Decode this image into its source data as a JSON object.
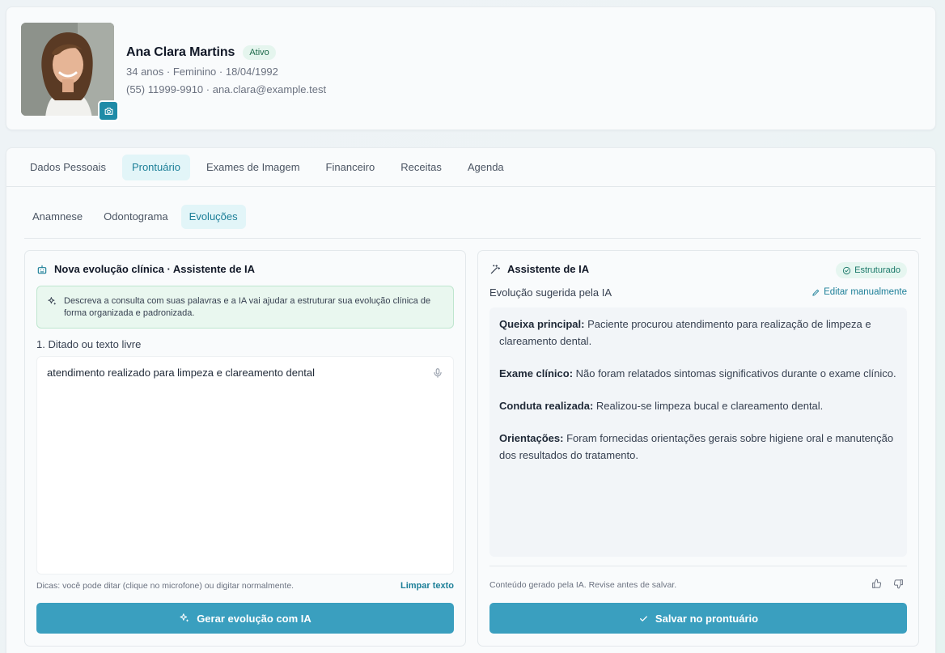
{
  "patient": {
    "name": "Ana Clara Martins",
    "status": "Ativo",
    "details": "34 anos · Feminino · 18/04/1992",
    "contact": "(55) 11999-9910 · ana.clara@example.test"
  },
  "tabs": [
    {
      "label": "Dados Pessoais",
      "active": false
    },
    {
      "label": "Prontuário",
      "active": true
    },
    {
      "label": "Exames de Imagem",
      "active": false
    },
    {
      "label": "Financeiro",
      "active": false
    },
    {
      "label": "Receitas",
      "active": false
    },
    {
      "label": "Agenda",
      "active": false
    }
  ],
  "subtabs": [
    {
      "label": "Anamnese",
      "active": false
    },
    {
      "label": "Odontograma",
      "active": false
    },
    {
      "label": "Evoluções",
      "active": true
    }
  ],
  "left_panel": {
    "title": "Nova evolução clínica · Assistente de IA",
    "info": "Descreva a consulta com suas palavras e a IA vai ajudar a estruturar sua evolução clínica de forma organizada e padronizada.",
    "section_label": "1. Ditado ou texto livre",
    "input_value": "atendimento realizado para limpeza e clareamento dental",
    "hint": "Dicas: você pode ditar (clique no microfone) ou digitar normalmente.",
    "clear_label": "Limpar texto",
    "generate_label": "Gerar evolução com IA"
  },
  "right_panel": {
    "title": "Assistente de IA",
    "badge": "Estruturado",
    "suggestion_label": "Evolução sugerida pela IA",
    "edit_label": "Editar manualmente",
    "sections": [
      {
        "heading": "Queixa principal:",
        "text": " Paciente procurou atendimento para realização de limpeza e clareamento dental."
      },
      {
        "heading": "Exame clínico:",
        "text": " Não foram relatados sintomas significativos durante o exame clínico."
      },
      {
        "heading": "Conduta realizada:",
        "text": " Realizou-se limpeza bucal e clareamento dental."
      },
      {
        "heading": "Orientações:",
        "text": " Foram fornecidas orientações gerais sobre higiene oral e manutenção dos resultados do tratamento."
      }
    ],
    "footer": "Conteúdo gerado pela IA. Revise antes de salvar.",
    "save_label": "Salvar no prontuário"
  },
  "icons": {
    "camera": "camera-icon",
    "mic": "microphone-icon",
    "sparkle": "sparkles-icon",
    "wand": "magic-wand-icon",
    "check": "check-icon",
    "edit": "pencil-icon",
    "thumbs_up": "thumbs-up-icon",
    "thumbs_down": "thumbs-down-icon"
  },
  "colors": {
    "accent": "#3a9fbf",
    "accent_text": "#1c7f98",
    "info_bg": "#e9f7ef",
    "status_bg": "#e5f5ee"
  }
}
